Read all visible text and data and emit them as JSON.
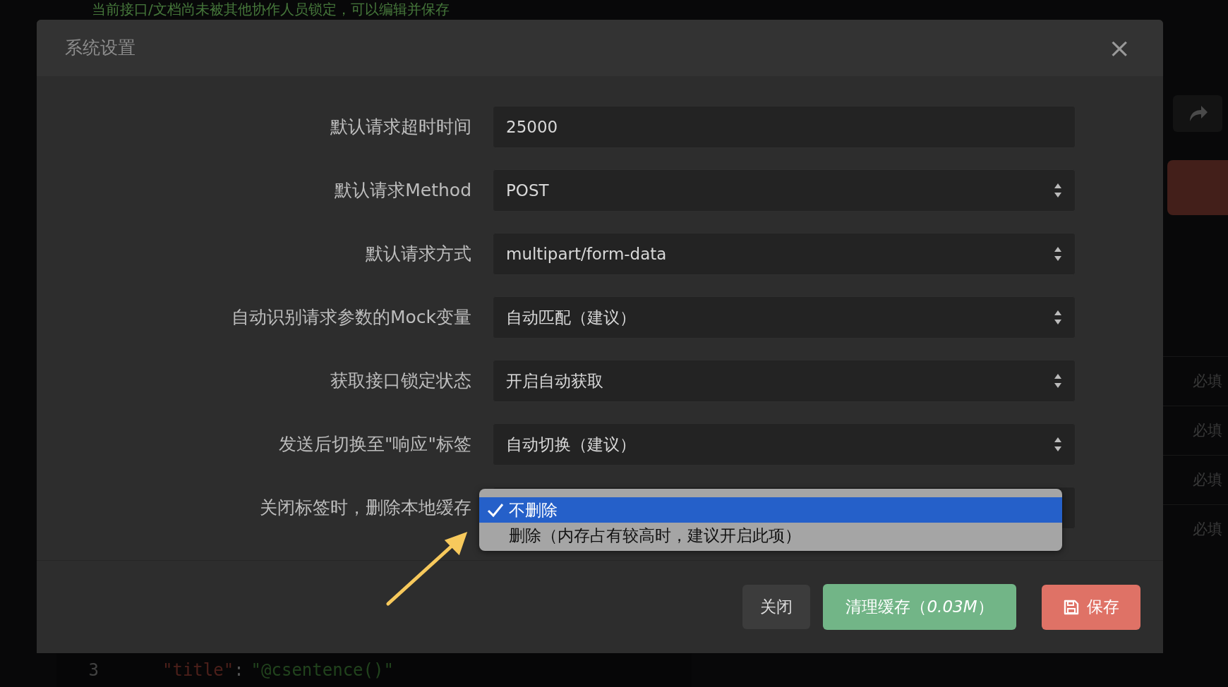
{
  "background": {
    "notice": "当前接口/文档尚未被其他协作人员锁定，可以编辑并保存",
    "required_cells": [
      "必填",
      "必填",
      "必填",
      "必填"
    ],
    "code_line": {
      "number": "3",
      "key": "\"title\"",
      "colon": ":",
      "value": "\"@csentence()\""
    }
  },
  "dialog": {
    "title": "系统设置",
    "close": "×",
    "fields": [
      {
        "kind": "input",
        "label": "默认请求超时时间",
        "value": "25000"
      },
      {
        "kind": "select",
        "label": "默认请求Method",
        "value": "POST"
      },
      {
        "kind": "select",
        "label": "默认请求方式",
        "value": "multipart/form-data"
      },
      {
        "kind": "select",
        "label": "自动识别请求参数的Mock变量",
        "value": "自动匹配（建议）"
      },
      {
        "kind": "select",
        "label": "获取接口锁定状态",
        "value": "开启自动获取"
      },
      {
        "kind": "select",
        "label": "发送后切换至\"响应\"标签",
        "value": "自动切换（建议）"
      },
      {
        "kind": "dropdown",
        "label": "关闭标签时，删除本地缓存",
        "options": [
          {
            "label": "不删除",
            "selected": true
          },
          {
            "label": "删除（内存占有较高时，建议开启此项）",
            "selected": false
          }
        ]
      }
    ],
    "buttons": [
      {
        "kind": "close",
        "label": "关闭"
      },
      {
        "kind": "clear",
        "label": "清理缓存（*0.03M*）"
      },
      {
        "kind": "save",
        "label": "保存"
      }
    ]
  }
}
